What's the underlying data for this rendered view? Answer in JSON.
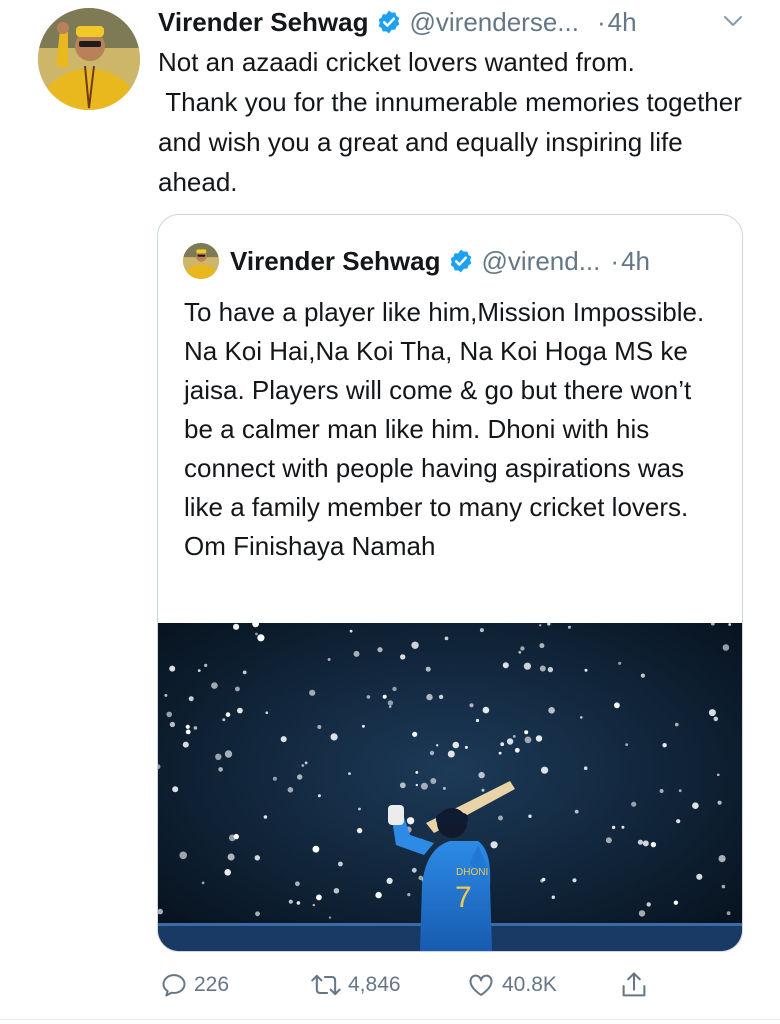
{
  "tweet": {
    "author_name": "Virender Sehwag",
    "handle": "@virenderse...",
    "separator": "·",
    "time": "4h",
    "text": "Not an azaadi cricket lovers wanted from.\n Thank you for the innumerable memories together and wish you a great and equally inspiring life ahead."
  },
  "quoted_tweet": {
    "author_name": "Virender Sehwag",
    "handle": "@virend...",
    "separator": "·",
    "time": "4h",
    "text": "To have a player like him,Mission Impossible. Na Koi Hai,Na Koi Tha, Na Koi Hoga MS ke jaisa. Players will come & go but there won’t be a calmer man like him. Dhoni with his connect with people having aspirations was like a family member to many cricket lovers. Om Finishaya Namah",
    "photo_jersey_name": "DHONI",
    "photo_jersey_number": "7"
  },
  "actions": {
    "replies": "226",
    "retweets": "4,846",
    "likes": "40.8K"
  },
  "colors": {
    "verified_blue": "#1da1f2",
    "meta_gray": "#657786",
    "border": "#ccd6dd",
    "jersey_blue": "#1f6fd1"
  },
  "icons": [
    "verified-badge-icon",
    "chevron-down-icon",
    "reply-icon",
    "retweet-icon",
    "like-icon",
    "share-icon"
  ]
}
